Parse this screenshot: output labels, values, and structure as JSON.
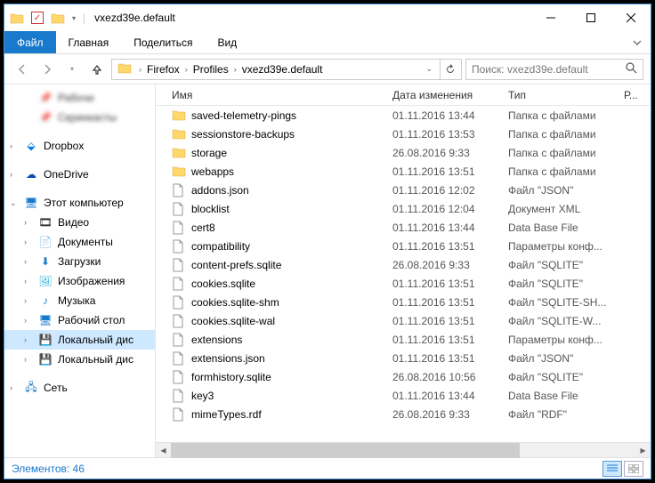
{
  "window": {
    "title": "vxezd39e.default"
  },
  "ribbon": {
    "file": "Файл",
    "tabs": [
      "Главная",
      "Поделиться",
      "Вид"
    ]
  },
  "breadcrumb": {
    "segments": [
      "Firefox",
      "Profiles",
      "vxezd39e.default"
    ]
  },
  "search": {
    "placeholder": "Поиск: vxezd39e.default"
  },
  "nav": {
    "quick1": "Рабочи",
    "quick2": "Скринкасты",
    "dropbox": "Dropbox",
    "onedrive": "OneDrive",
    "thispc": "Этот компьютер",
    "video": "Видео",
    "documents": "Документы",
    "downloads": "Загрузки",
    "pictures": "Изображения",
    "music": "Музыка",
    "desktop": "Рабочий стол",
    "localdisk": "Локальный дис",
    "localdisk2": "Локальный дис",
    "network": "Сеть"
  },
  "columns": {
    "name": "Имя",
    "date": "Дата изменения",
    "type": "Тип",
    "size": "Р..."
  },
  "files": [
    {
      "icon": "folder",
      "name": "saved-telemetry-pings",
      "date": "01.11.2016 13:44",
      "type": "Папка с файлами"
    },
    {
      "icon": "folder",
      "name": "sessionstore-backups",
      "date": "01.11.2016 13:53",
      "type": "Папка с файлами"
    },
    {
      "icon": "folder",
      "name": "storage",
      "date": "26.08.2016 9:33",
      "type": "Папка с файлами"
    },
    {
      "icon": "folder",
      "name": "webapps",
      "date": "01.11.2016 13:51",
      "type": "Папка с файлами"
    },
    {
      "icon": "file",
      "name": "addons.json",
      "date": "01.11.2016 12:02",
      "type": "Файл \"JSON\""
    },
    {
      "icon": "file",
      "name": "blocklist",
      "date": "01.11.2016 12:04",
      "type": "Документ XML"
    },
    {
      "icon": "file",
      "name": "cert8",
      "date": "01.11.2016 13:44",
      "type": "Data Base File"
    },
    {
      "icon": "file",
      "name": "compatibility",
      "date": "01.11.2016 13:51",
      "type": "Параметры конф..."
    },
    {
      "icon": "file",
      "name": "content-prefs.sqlite",
      "date": "26.08.2016 9:33",
      "type": "Файл \"SQLITE\""
    },
    {
      "icon": "file",
      "name": "cookies.sqlite",
      "date": "01.11.2016 13:51",
      "type": "Файл \"SQLITE\""
    },
    {
      "icon": "file",
      "name": "cookies.sqlite-shm",
      "date": "01.11.2016 13:51",
      "type": "Файл \"SQLITE-SH..."
    },
    {
      "icon": "file",
      "name": "cookies.sqlite-wal",
      "date": "01.11.2016 13:51",
      "type": "Файл \"SQLITE-W..."
    },
    {
      "icon": "file",
      "name": "extensions",
      "date": "01.11.2016 13:51",
      "type": "Параметры конф..."
    },
    {
      "icon": "file",
      "name": "extensions.json",
      "date": "01.11.2016 13:51",
      "type": "Файл \"JSON\""
    },
    {
      "icon": "file",
      "name": "formhistory.sqlite",
      "date": "26.08.2016 10:56",
      "type": "Файл \"SQLITE\""
    },
    {
      "icon": "file",
      "name": "key3",
      "date": "01.11.2016 13:44",
      "type": "Data Base File"
    },
    {
      "icon": "file",
      "name": "mimeTypes.rdf",
      "date": "26.08.2016 9:33",
      "type": "Файл \"RDF\""
    }
  ],
  "status": {
    "text": "Элементов: 46"
  }
}
